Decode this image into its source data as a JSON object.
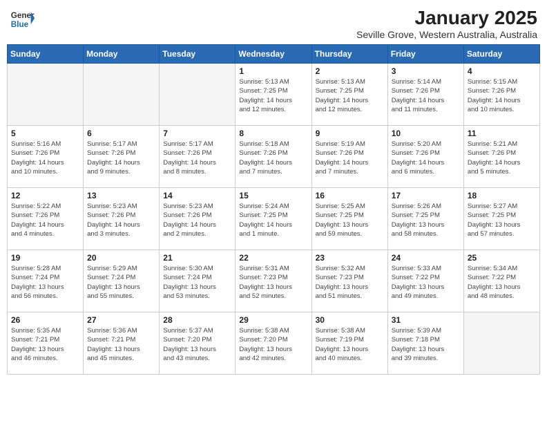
{
  "header": {
    "logo_line1": "General",
    "logo_line2": "Blue",
    "title": "January 2025",
    "subtitle": "Seville Grove, Western Australia, Australia"
  },
  "calendar": {
    "days_of_week": [
      "Sunday",
      "Monday",
      "Tuesday",
      "Wednesday",
      "Thursday",
      "Friday",
      "Saturday"
    ],
    "weeks": [
      [
        {
          "day": "",
          "info": ""
        },
        {
          "day": "",
          "info": ""
        },
        {
          "day": "",
          "info": ""
        },
        {
          "day": "1",
          "info": "Sunrise: 5:13 AM\nSunset: 7:25 PM\nDaylight: 14 hours\nand 12 minutes."
        },
        {
          "day": "2",
          "info": "Sunrise: 5:13 AM\nSunset: 7:25 PM\nDaylight: 14 hours\nand 12 minutes."
        },
        {
          "day": "3",
          "info": "Sunrise: 5:14 AM\nSunset: 7:26 PM\nDaylight: 14 hours\nand 11 minutes."
        },
        {
          "day": "4",
          "info": "Sunrise: 5:15 AM\nSunset: 7:26 PM\nDaylight: 14 hours\nand 10 minutes."
        }
      ],
      [
        {
          "day": "5",
          "info": "Sunrise: 5:16 AM\nSunset: 7:26 PM\nDaylight: 14 hours\nand 10 minutes."
        },
        {
          "day": "6",
          "info": "Sunrise: 5:17 AM\nSunset: 7:26 PM\nDaylight: 14 hours\nand 9 minutes."
        },
        {
          "day": "7",
          "info": "Sunrise: 5:17 AM\nSunset: 7:26 PM\nDaylight: 14 hours\nand 8 minutes."
        },
        {
          "day": "8",
          "info": "Sunrise: 5:18 AM\nSunset: 7:26 PM\nDaylight: 14 hours\nand 7 minutes."
        },
        {
          "day": "9",
          "info": "Sunrise: 5:19 AM\nSunset: 7:26 PM\nDaylight: 14 hours\nand 7 minutes."
        },
        {
          "day": "10",
          "info": "Sunrise: 5:20 AM\nSunset: 7:26 PM\nDaylight: 14 hours\nand 6 minutes."
        },
        {
          "day": "11",
          "info": "Sunrise: 5:21 AM\nSunset: 7:26 PM\nDaylight: 14 hours\nand 5 minutes."
        }
      ],
      [
        {
          "day": "12",
          "info": "Sunrise: 5:22 AM\nSunset: 7:26 PM\nDaylight: 14 hours\nand 4 minutes."
        },
        {
          "day": "13",
          "info": "Sunrise: 5:23 AM\nSunset: 7:26 PM\nDaylight: 14 hours\nand 3 minutes."
        },
        {
          "day": "14",
          "info": "Sunrise: 5:23 AM\nSunset: 7:26 PM\nDaylight: 14 hours\nand 2 minutes."
        },
        {
          "day": "15",
          "info": "Sunrise: 5:24 AM\nSunset: 7:25 PM\nDaylight: 14 hours\nand 1 minute."
        },
        {
          "day": "16",
          "info": "Sunrise: 5:25 AM\nSunset: 7:25 PM\nDaylight: 13 hours\nand 59 minutes."
        },
        {
          "day": "17",
          "info": "Sunrise: 5:26 AM\nSunset: 7:25 PM\nDaylight: 13 hours\nand 58 minutes."
        },
        {
          "day": "18",
          "info": "Sunrise: 5:27 AM\nSunset: 7:25 PM\nDaylight: 13 hours\nand 57 minutes."
        }
      ],
      [
        {
          "day": "19",
          "info": "Sunrise: 5:28 AM\nSunset: 7:24 PM\nDaylight: 13 hours\nand 56 minutes."
        },
        {
          "day": "20",
          "info": "Sunrise: 5:29 AM\nSunset: 7:24 PM\nDaylight: 13 hours\nand 55 minutes."
        },
        {
          "day": "21",
          "info": "Sunrise: 5:30 AM\nSunset: 7:24 PM\nDaylight: 13 hours\nand 53 minutes."
        },
        {
          "day": "22",
          "info": "Sunrise: 5:31 AM\nSunset: 7:23 PM\nDaylight: 13 hours\nand 52 minutes."
        },
        {
          "day": "23",
          "info": "Sunrise: 5:32 AM\nSunset: 7:23 PM\nDaylight: 13 hours\nand 51 minutes."
        },
        {
          "day": "24",
          "info": "Sunrise: 5:33 AM\nSunset: 7:22 PM\nDaylight: 13 hours\nand 49 minutes."
        },
        {
          "day": "25",
          "info": "Sunrise: 5:34 AM\nSunset: 7:22 PM\nDaylight: 13 hours\nand 48 minutes."
        }
      ],
      [
        {
          "day": "26",
          "info": "Sunrise: 5:35 AM\nSunset: 7:21 PM\nDaylight: 13 hours\nand 46 minutes."
        },
        {
          "day": "27",
          "info": "Sunrise: 5:36 AM\nSunset: 7:21 PM\nDaylight: 13 hours\nand 45 minutes."
        },
        {
          "day": "28",
          "info": "Sunrise: 5:37 AM\nSunset: 7:20 PM\nDaylight: 13 hours\nand 43 minutes."
        },
        {
          "day": "29",
          "info": "Sunrise: 5:38 AM\nSunset: 7:20 PM\nDaylight: 13 hours\nand 42 minutes."
        },
        {
          "day": "30",
          "info": "Sunrise: 5:38 AM\nSunset: 7:19 PM\nDaylight: 13 hours\nand 40 minutes."
        },
        {
          "day": "31",
          "info": "Sunrise: 5:39 AM\nSunset: 7:18 PM\nDaylight: 13 hours\nand 39 minutes."
        },
        {
          "day": "",
          "info": ""
        }
      ]
    ]
  }
}
